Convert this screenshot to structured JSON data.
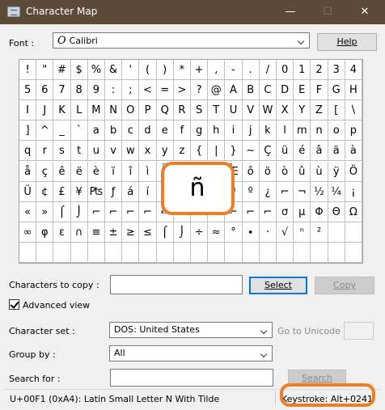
{
  "window": {
    "title": "Character Map",
    "minimize": "—",
    "maximize": "☐",
    "close": "✕"
  },
  "font_row": {
    "label": "Font :",
    "value": "Calibri",
    "font_type_glyph": "O",
    "help_label": "Help"
  },
  "grid": {
    "rows": [
      [
        "!",
        "\"",
        "#",
        "$",
        "%",
        "&",
        "'",
        "(",
        ")",
        "*",
        "+",
        ",",
        "-",
        ".",
        "/",
        "0",
        "1",
        "2",
        "3",
        "4"
      ],
      [
        "5",
        "6",
        "7",
        "8",
        "9",
        ":",
        ";",
        "<",
        "=",
        ">",
        "?",
        "@",
        "A",
        "B",
        "C",
        "D",
        "E",
        "F",
        "G",
        "H"
      ],
      [
        "I",
        "J",
        "K",
        "L",
        "M",
        "N",
        "O",
        "P",
        "Q",
        "R",
        "S",
        "T",
        "U",
        "V",
        "W",
        "X",
        "Y",
        "Z",
        "[",
        "\\"
      ],
      [
        "]",
        "^",
        "_",
        "`",
        "a",
        "b",
        "c",
        "d",
        "e",
        "f",
        "g",
        "h",
        "i",
        "j",
        "k",
        "l",
        "m",
        "n",
        "o",
        "p"
      ],
      [
        "q",
        "r",
        "s",
        "t",
        "u",
        "v",
        "w",
        "x",
        "y",
        "z",
        "{",
        "|",
        "}",
        "~",
        "Ç",
        "ü",
        "é",
        "â",
        "ä",
        "à"
      ],
      [
        "å",
        "ç",
        "ê",
        "ë",
        "è",
        "ï",
        "î",
        "ì",
        "Ä",
        "Å",
        "É",
        "æ",
        "Æ",
        "ô",
        "ö",
        "ò",
        "û",
        "ù",
        "ÿ",
        "Ö"
      ],
      [
        "Ü",
        "¢",
        "£",
        "¥",
        "₧",
        "ƒ",
        "á",
        "í",
        "ó",
        "ú",
        "ñ",
        "Ñ",
        "ª",
        "º",
        "¿",
        "⌐",
        "¬",
        "½",
        "¼",
        "¡"
      ],
      [
        "«",
        "»",
        "⌠",
        "⌡",
        "⌐",
        "⌐",
        "⌐",
        "⌐",
        "⌐",
        "⌐",
        "⌐",
        "⌐",
        "⌐",
        "⌐",
        "⌐",
        "σ",
        "µ",
        "Φ",
        "Θ",
        "Ω"
      ],
      [
        "∞",
        "φ",
        "ε",
        "∩",
        "≡",
        "±",
        "≥",
        "≤",
        "⌠",
        "⌡",
        "÷",
        "≈",
        "°",
        "∙",
        "·",
        "√",
        "ⁿ",
        "²",
        "",
        ""
      ],
      [
        "",
        "",
        "",
        "",
        "",
        "",
        "",
        "",
        "",
        "",
        "",
        "",
        "",
        "",
        "",
        "",
        "",
        "",
        "",
        ""
      ]
    ]
  },
  "zoom_char": "ñ",
  "copy_row": {
    "label": "Characters to copy :",
    "value": "",
    "select_label": "Select",
    "copy_label": "Copy"
  },
  "advanced_view": {
    "label": "Advanced view",
    "checked": true
  },
  "charset_row": {
    "label": "Character set :",
    "value": "DOS: United States",
    "goto_label": "Go to Unicode :",
    "goto_value": ""
  },
  "groupby_row": {
    "label": "Group by :",
    "value": "All"
  },
  "search_row": {
    "label": "Search for :",
    "value": "",
    "search_label": "Search"
  },
  "status": {
    "description": "U+00F1 (0xA4): Latin Small Letter N With Tilde",
    "keystroke": "Keystroke: Alt+0241"
  },
  "colors": {
    "titlebar": "#5a4a37",
    "highlight": "#ef7d22",
    "default_button_border": "#0078d7"
  }
}
